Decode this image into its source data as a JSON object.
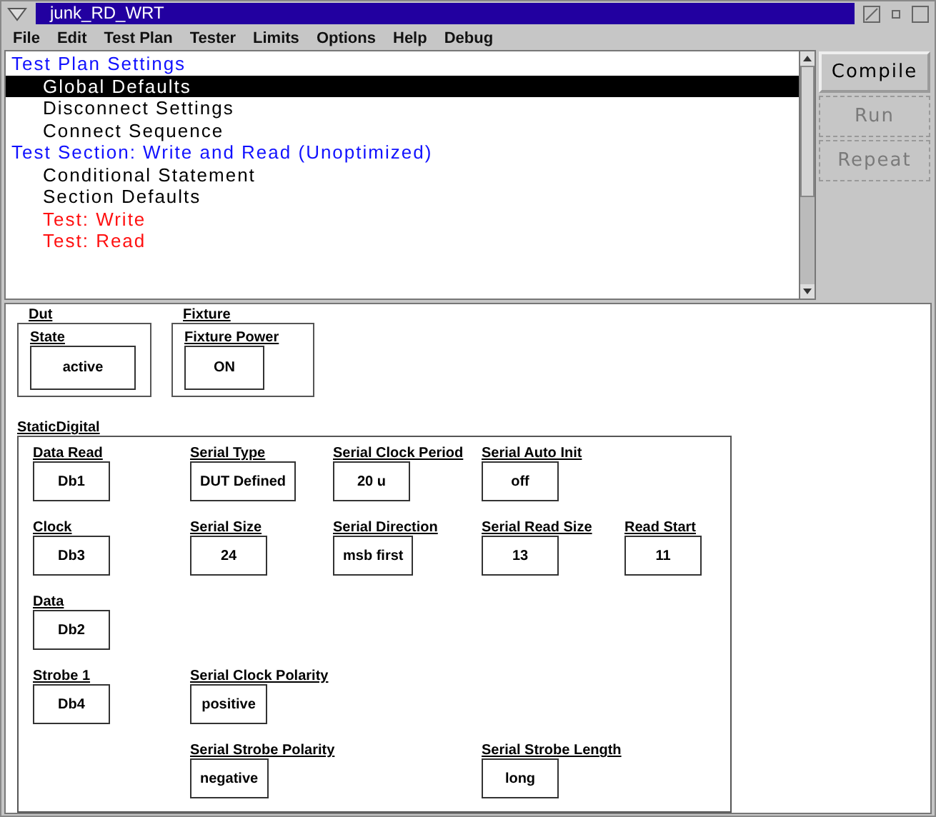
{
  "window": {
    "title": "junk_RD_WRT"
  },
  "menu": [
    "File",
    "Edit",
    "Test Plan",
    "Tester",
    "Limits",
    "Options",
    "Help",
    "Debug"
  ],
  "tree": [
    {
      "label": "Test Plan Settings",
      "kind": "section",
      "selected": false,
      "children": [
        {
          "label": "Global Defaults",
          "kind": "item",
          "selected": true
        },
        {
          "label": "Disconnect Settings",
          "kind": "item",
          "selected": false
        },
        {
          "label": "Connect Sequence",
          "kind": "item",
          "selected": false
        }
      ]
    },
    {
      "label": "Test Section: Write and Read (Unoptimized)",
      "kind": "section",
      "selected": false,
      "children": [
        {
          "label": "Conditional Statement",
          "kind": "item",
          "selected": false
        },
        {
          "label": "Section Defaults",
          "kind": "item",
          "selected": false
        },
        {
          "label": "Test: Write",
          "kind": "test",
          "selected": false
        },
        {
          "label": "Test: Read",
          "kind": "test",
          "selected": false
        }
      ]
    }
  ],
  "buttons": [
    {
      "label": "Compile",
      "disabled": false
    },
    {
      "label": "Run",
      "disabled": true
    },
    {
      "label": "Repeat",
      "disabled": true
    }
  ],
  "groups": [
    {
      "title": "Dut",
      "fields": [
        {
          "label": "State",
          "value": "active"
        }
      ]
    },
    {
      "title": "Fixture",
      "fields": [
        {
          "label": "Fixture Power",
          "value": "ON"
        }
      ]
    },
    {
      "title": "StaticDigital",
      "fields": [
        {
          "label": "Data Read",
          "value": "Db1"
        },
        {
          "label": "Serial Type",
          "value": "DUT Defined"
        },
        {
          "label": "Serial Clock Period",
          "value": "20 u"
        },
        {
          "label": "Serial Auto Init",
          "value": "off"
        },
        {
          "label": "Clock",
          "value": "Db3"
        },
        {
          "label": "Serial Size",
          "value": "24"
        },
        {
          "label": "Serial Direction",
          "value": "msb first"
        },
        {
          "label": "Serial Read Size",
          "value": "13"
        },
        {
          "label": "Read Start",
          "value": "11"
        },
        {
          "label": "Data",
          "value": "Db2"
        },
        {
          "label": "Strobe 1",
          "value": "Db4"
        },
        {
          "label": "Serial Clock Polarity",
          "value": "positive"
        },
        {
          "label": "Serial Strobe Polarity",
          "value": "negative"
        },
        {
          "label": "Serial Strobe Length",
          "value": "long"
        }
      ]
    }
  ]
}
